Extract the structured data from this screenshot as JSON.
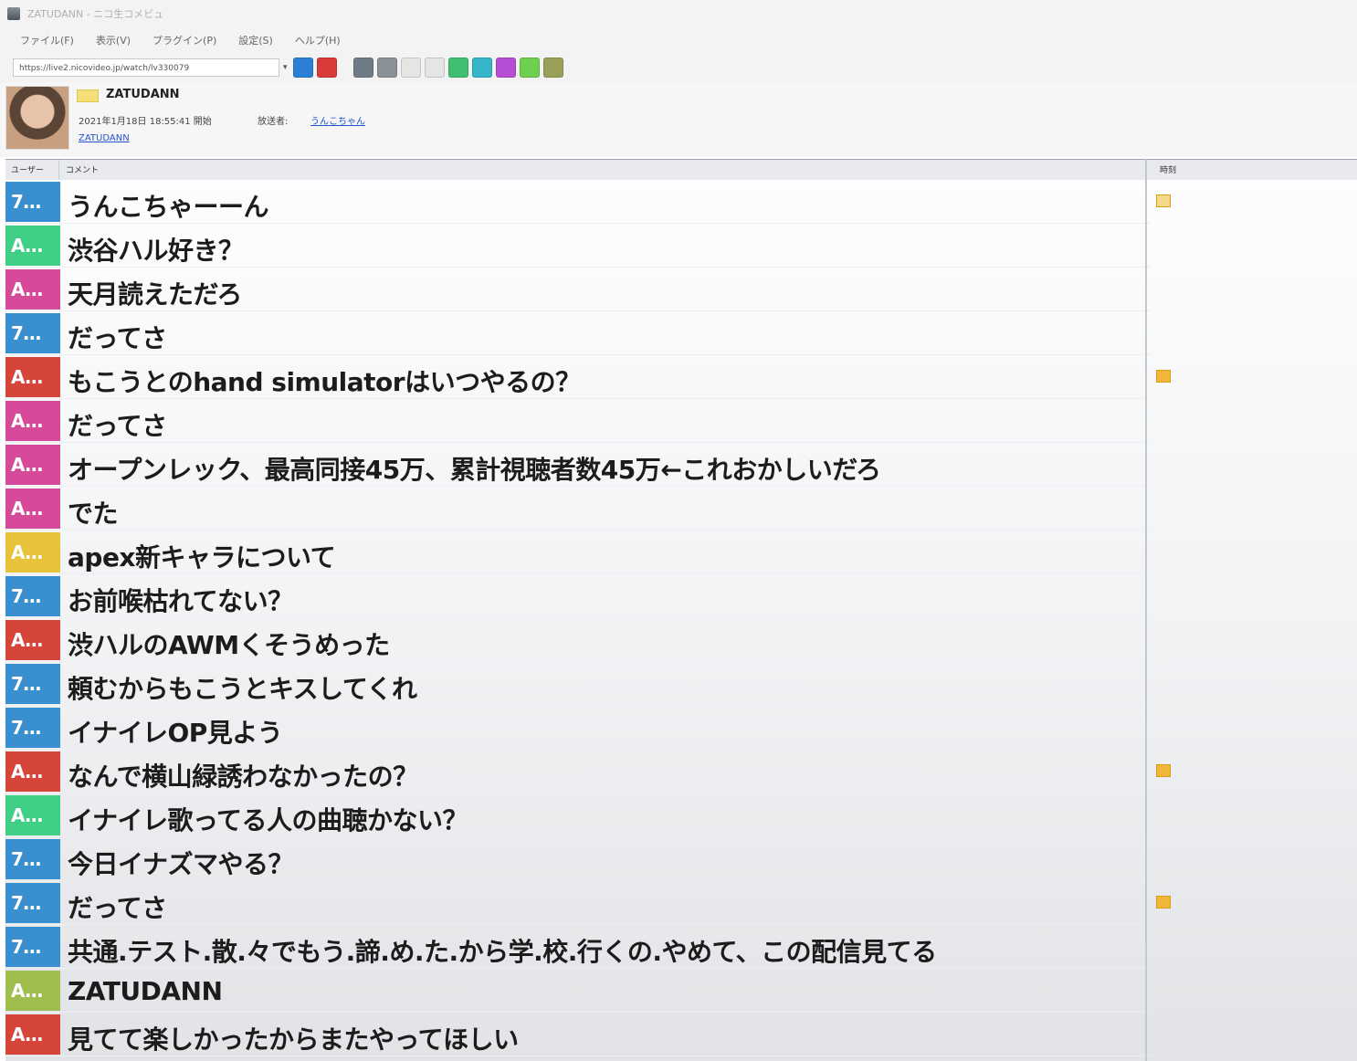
{
  "window": {
    "title": "ZATUDANN - ニコ生コメビュ"
  },
  "menu": [
    "ファイル(F)",
    "表示(V)",
    "プラグイン(P)",
    "設定(S)",
    "ヘルプ(H)"
  ],
  "toolbar": {
    "url": "https://live2.nicovideo.jp/watch/lv330079",
    "button_colors": [
      "#2b7fd4",
      "#d93a3a",
      "#707b88",
      "#8a9097",
      "#e5e5e5",
      "#e5e5e5",
      "#3fbf6f",
      "#35b5c8",
      "#b64fd6",
      "#6fcf4f",
      "#9aa05a"
    ]
  },
  "stream": {
    "channel_name": "ZATUDANN",
    "start_time": "2021年1月18日 18:55:41 開始",
    "owner_label": "放送者:",
    "owner_name": "うんこちゃん",
    "community_link": "ZATUDANN"
  },
  "columns": {
    "user": "ユーザー",
    "comment": "コメント",
    "time": "時刻"
  },
  "comments": [
    {
      "user": "7...",
      "color": "#3a8fd0",
      "text": "うんこちゃーーん",
      "flag": "#f3d98a"
    },
    {
      "user": "A...",
      "color": "#3fcf85",
      "text": "渋谷ハル好き？",
      "flag": ""
    },
    {
      "user": "A...",
      "color": "#d64a9a",
      "text": "天月読えただろ",
      "flag": ""
    },
    {
      "user": "7...",
      "color": "#3a8fd0",
      "text": "だってさ",
      "flag": ""
    },
    {
      "user": "A...",
      "color": "#d6453a",
      "text": "もこうとのhand simulatorはいつやるの？",
      "flag": "#f2b73a"
    },
    {
      "user": "A...",
      "color": "#d64a9a",
      "text": "だってさ",
      "flag": ""
    },
    {
      "user": "A...",
      "color": "#d64a9a",
      "text": "オープンレック、最高同接45万、累計視聴者数45万←これおかしいだろ",
      "flag": ""
    },
    {
      "user": "A...",
      "color": "#d64a9a",
      "text": "でた",
      "flag": ""
    },
    {
      "user": "A...",
      "color": "#e6c33a",
      "text": "apex新キャラについて",
      "flag": ""
    },
    {
      "user": "7...",
      "color": "#3a8fd0",
      "text": "お前喉枯れてない？",
      "flag": ""
    },
    {
      "user": "A...",
      "color": "#d6453a",
      "text": "渋ハルのAWMくそうめった",
      "flag": ""
    },
    {
      "user": "7...",
      "color": "#3a8fd0",
      "text": "頼むからもこうとキスしてくれ",
      "flag": ""
    },
    {
      "user": "7...",
      "color": "#3a8fd0",
      "text": "イナイレOP見よう",
      "flag": ""
    },
    {
      "user": "A...",
      "color": "#d6453a",
      "text": "なんで横山緑誘わなかったの？",
      "flag": "#f2b73a"
    },
    {
      "user": "A...",
      "color": "#3fcf85",
      "text": "イナイレ歌ってる人の曲聴かない？",
      "flag": ""
    },
    {
      "user": "7...",
      "color": "#3a8fd0",
      "text": "今日イナズマやる？",
      "flag": ""
    },
    {
      "user": "7...",
      "color": "#3a8fd0",
      "text": "だってさ",
      "flag": "#f2b73a"
    },
    {
      "user": "7...",
      "color": "#3a8fd0",
      "text": "共通.テスト.散.々でもう.諦.め.た.から学.校.行くの.やめて、この配信見てる",
      "flag": ""
    },
    {
      "user": "A...",
      "color": "#9fbe4e",
      "text": "ZATUDANN",
      "flag": ""
    },
    {
      "user": "A...",
      "color": "#d6453a",
      "text": "見てて楽しかったからまたやってほしい",
      "flag": ""
    }
  ]
}
